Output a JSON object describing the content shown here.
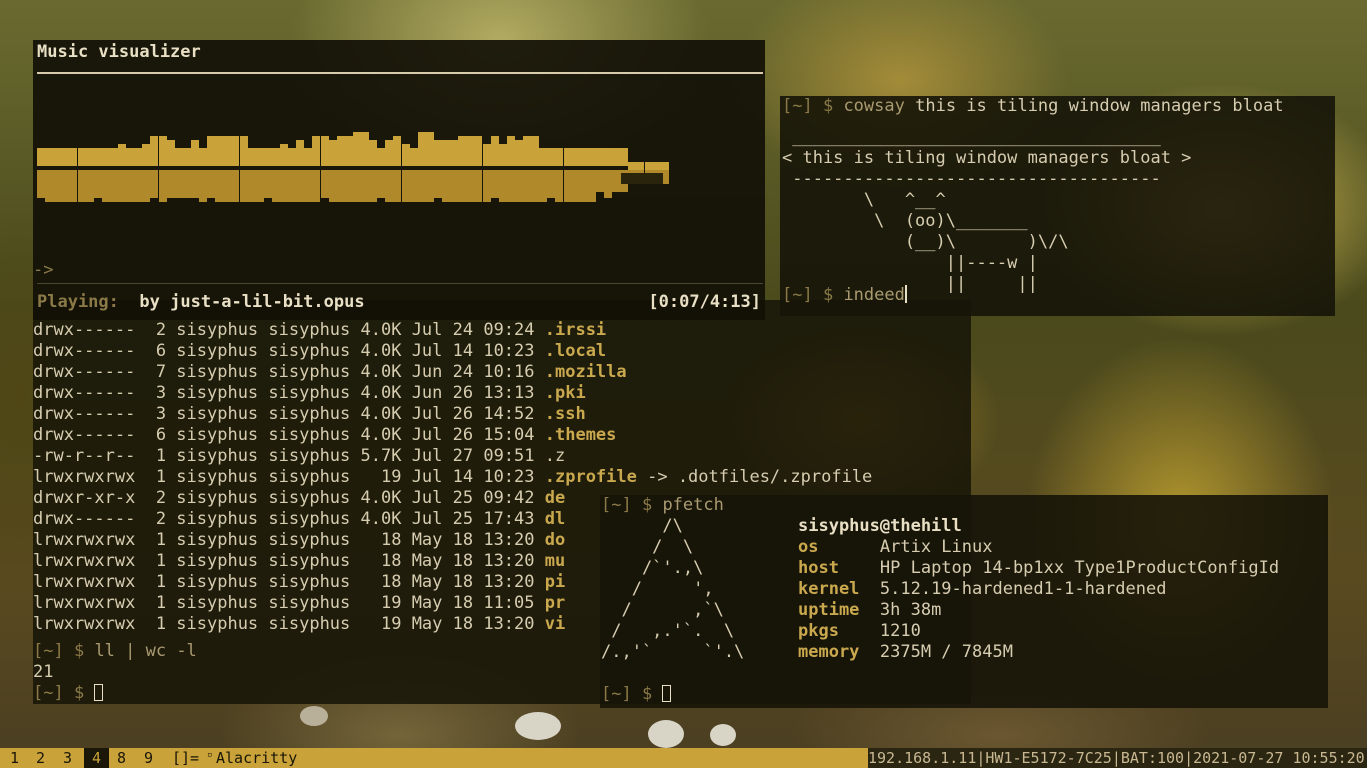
{
  "visualizer": {
    "title": "Music visualizer",
    "arrow": "->",
    "playing_label": "Playing:",
    "by_label": "by",
    "track": "just-a-lil-bit.opus",
    "time": "[0:07/4:13]",
    "accent_color": "#c9a339"
  },
  "listing": {
    "rows": [
      {
        "perms": "drwx------",
        "links": "2",
        "user": "sisyphus",
        "group": "sisyphus",
        "size": "4.0K",
        "date": "Jul 24 09:24",
        "name": ".irssi"
      },
      {
        "perms": "drwx------",
        "links": "6",
        "user": "sisyphus",
        "group": "sisyphus",
        "size": "4.0K",
        "date": "Jul 14 10:23",
        "name": ".local"
      },
      {
        "perms": "drwx------",
        "links": "7",
        "user": "sisyphus",
        "group": "sisyphus",
        "size": "4.0K",
        "date": "Jun 24 10:16",
        "name": ".mozilla"
      },
      {
        "perms": "drwx------",
        "links": "3",
        "user": "sisyphus",
        "group": "sisyphus",
        "size": "4.0K",
        "date": "Jun 26 13:13",
        "name": ".pki"
      },
      {
        "perms": "drwx------",
        "links": "3",
        "user": "sisyphus",
        "group": "sisyphus",
        "size": "4.0K",
        "date": "Jul 26 14:52",
        "name": ".ssh"
      },
      {
        "perms": "drwx------",
        "links": "6",
        "user": "sisyphus",
        "group": "sisyphus",
        "size": "4.0K",
        "date": "Jul 26 15:04",
        "name": ".themes"
      },
      {
        "perms": "-rw-r--r--",
        "links": "1",
        "user": "sisyphus",
        "group": "sisyphus",
        "size": "5.7K",
        "date": "Jul 27 09:51",
        "name": ".z"
      },
      {
        "perms": "lrwxrwxrwx",
        "links": "1",
        "user": "sisyphus",
        "group": "sisyphus",
        "size": "19",
        "date": "Jul 14 10:23",
        "name": ".zprofile",
        "target": "-> .dotfiles/.zprofile"
      },
      {
        "perms": "drwxr-xr-x",
        "links": "2",
        "user": "sisyphus",
        "group": "sisyphus",
        "size": "4.0K",
        "date": "Jul 25 09:42",
        "name": "de"
      },
      {
        "perms": "drwx------",
        "links": "2",
        "user": "sisyphus",
        "group": "sisyphus",
        "size": "4.0K",
        "date": "Jul 25 17:43",
        "name": "dl"
      },
      {
        "perms": "lrwxrwxrwx",
        "links": "1",
        "user": "sisyphus",
        "group": "sisyphus",
        "size": "18",
        "date": "May 18 13:20",
        "name": "do"
      },
      {
        "perms": "lrwxrwxrwx",
        "links": "1",
        "user": "sisyphus",
        "group": "sisyphus",
        "size": "18",
        "date": "May 18 13:20",
        "name": "mu"
      },
      {
        "perms": "lrwxrwxrwx",
        "links": "1",
        "user": "sisyphus",
        "group": "sisyphus",
        "size": "18",
        "date": "May 18 13:20",
        "name": "pi"
      },
      {
        "perms": "lrwxrwxrwx",
        "links": "1",
        "user": "sisyphus",
        "group": "sisyphus",
        "size": "19",
        "date": "May 18 11:05",
        "name": "pr"
      },
      {
        "perms": "lrwxrwxrwx",
        "links": "1",
        "user": "sisyphus",
        "group": "sisyphus",
        "size": "19",
        "date": "May 18 13:20",
        "name": "vi"
      }
    ],
    "prompt": "[~] $",
    "command": "ll | wc -l",
    "output": "21"
  },
  "cowsay": {
    "prompt": "[~] $",
    "command": "cowsay",
    "args": "this is tiling window managers bloat",
    "art": [
      " ____________________________________",
      "< this is tiling window managers bloat >",
      " ------------------------------------",
      "        \\   ^__^",
      "         \\  (oo)\\_______",
      "            (__)\\       )\\/\\",
      "                ||----w |",
      "                ||     ||"
    ],
    "command2": "indeed"
  },
  "pfetch": {
    "prompt": "[~] $",
    "command": "pfetch",
    "logo": [
      "      /\\",
      "     /  \\",
      "    /`'.,\\",
      "   /     ',",
      "  /      ,`\\",
      " /   ,.'`.  \\",
      "/.,'`     `'.\\"
    ],
    "user_host": "sisyphus@thehill",
    "fields": [
      {
        "key": "os",
        "value": "Artix Linux"
      },
      {
        "key": "host",
        "value": "HP Laptop 14-bp1xx Type1ProductConfigId"
      },
      {
        "key": "kernel",
        "value": "5.12.19-hardened1-1-hardened"
      },
      {
        "key": "uptime",
        "value": "3h 38m"
      },
      {
        "key": "pkgs",
        "value": "1210"
      },
      {
        "key": "memory",
        "value": "2375M / 7845M"
      }
    ]
  },
  "statusbar": {
    "workspaces": [
      "1",
      "2",
      "3",
      "4",
      "8",
      "9"
    ],
    "active_workspace": "4",
    "layout": "[]=",
    "window_title": "Alacritty",
    "status": "192.168.1.11|HW1-E5172-7C25|BAT:100|2021-07-27 10:55:20",
    "colors": {
      "bar": "#c9a339",
      "active": "#1a1608"
    }
  }
}
